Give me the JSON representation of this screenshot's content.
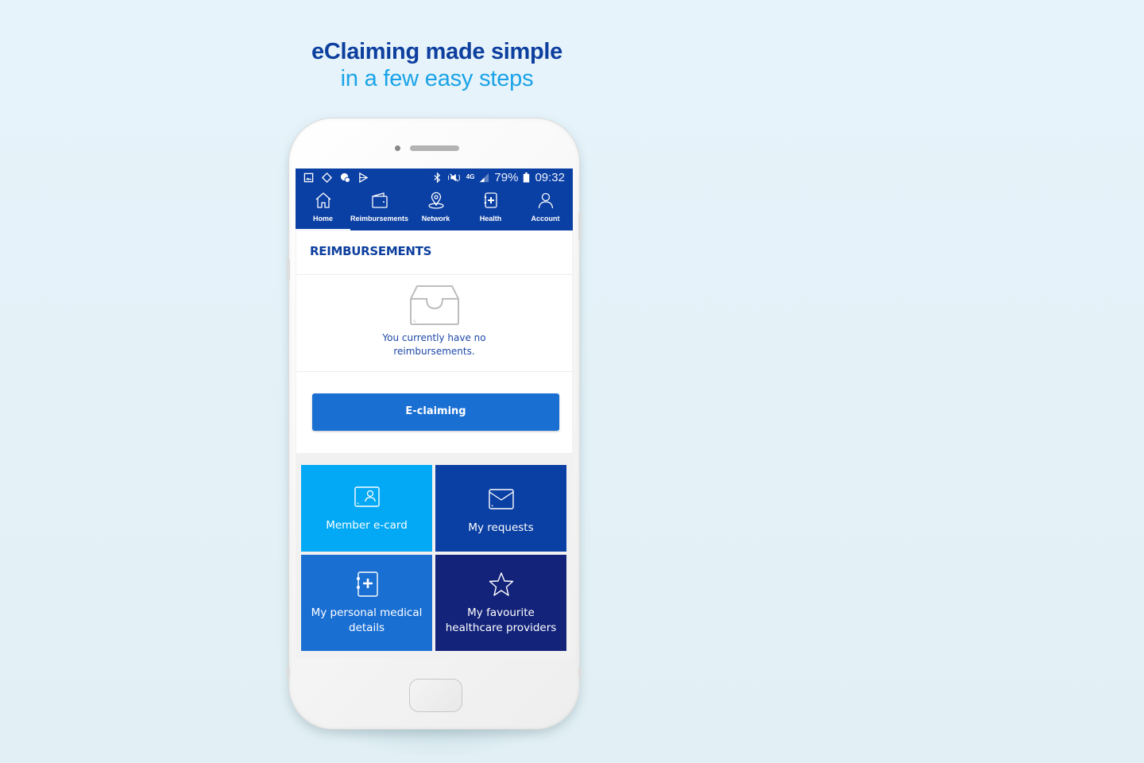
{
  "headline": {
    "line1": "eClaiming made simple",
    "line2": "in a few easy steps"
  },
  "statusbar": {
    "left_icons": [
      "gallery-icon",
      "screen-rotate-icon",
      "sync-icon",
      "play-store-icon"
    ],
    "right_icons": [
      "bluetooth-icon",
      "mute-icon",
      "4g-icon",
      "signal-icon",
      "battery-icon"
    ],
    "network": "4G",
    "battery": "79%",
    "time": "09:32"
  },
  "nav": {
    "items": [
      {
        "label": "Home",
        "icon": "home-icon",
        "active": true
      },
      {
        "label": "Reimbursements",
        "icon": "wallet-icon",
        "active": false
      },
      {
        "label": "Network",
        "icon": "location-pin-icon",
        "active": false
      },
      {
        "label": "Health",
        "icon": "medical-book-icon",
        "active": false
      },
      {
        "label": "Account",
        "icon": "user-icon",
        "active": false
      }
    ]
  },
  "reimbursements": {
    "title": "REIMBURSEMENTS",
    "empty_icon": "inbox-tray-icon",
    "empty_line1": "You currently have no",
    "empty_line2": "reimbursements.",
    "button_label": "E-claiming"
  },
  "tiles": [
    {
      "label": "Member e-card",
      "icon": "member-card-icon",
      "color": "#03a9f4"
    },
    {
      "label": "My requests",
      "icon": "envelope-icon",
      "color": "#0a3fa3"
    },
    {
      "label": "My personal medical details",
      "icon": "medical-book-icon",
      "color": "#1a6fd3"
    },
    {
      "label": "My favourite healthcare providers",
      "icon": "star-icon",
      "color": "#13237a"
    }
  ],
  "colors": {
    "brand_dark": "#0a3fa3",
    "brand_light": "#03a9f4",
    "button": "#1a6fd3",
    "navy": "#13237a"
  }
}
